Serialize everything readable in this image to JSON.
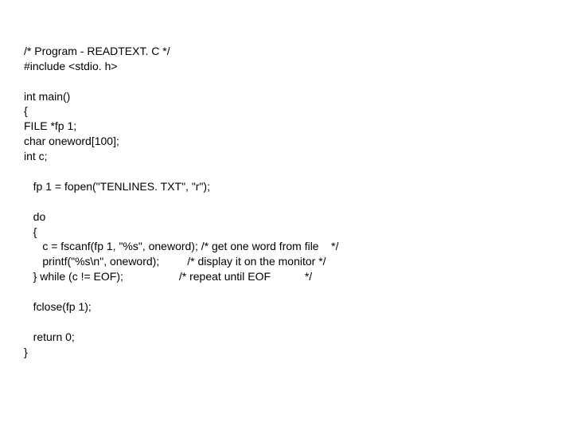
{
  "code": {
    "lines": [
      "/* Program - READTEXT. C */",
      "#include <stdio. h>",
      "",
      "int main()",
      "{",
      "FILE *fp 1;",
      "char oneword[100];",
      "int c;",
      "",
      "   fp 1 = fopen(\"TENLINES. TXT\", \"r\");",
      "",
      "   do",
      "   {",
      "      c = fscanf(fp 1, \"%s\", oneword); /* get one word from file    */",
      "      printf(\"%s\\n\", oneword);         /* display it on the monitor */",
      "   } while (c != EOF);                  /* repeat until EOF           */",
      "",
      "   fclose(fp 1);",
      "",
      "   return 0;",
      "}"
    ]
  }
}
